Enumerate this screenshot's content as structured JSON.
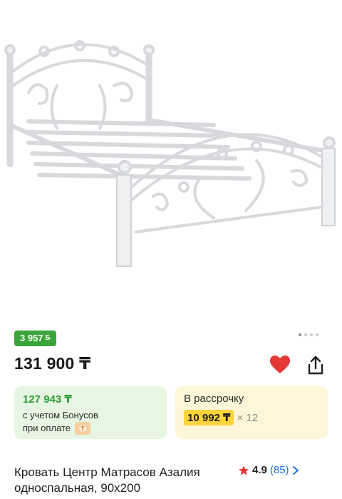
{
  "product": {
    "image_alt": "Кровать",
    "bonus_badge": "3 957",
    "bonus_symbol": "Б",
    "price": "131 900 ₸",
    "title": "Кровать Центр Матрасов Азалия односпальная, 90x200",
    "rating": "4.9",
    "reviews": "(85)"
  },
  "carousel": {
    "dots": 4,
    "active": 0
  },
  "bonus_card": {
    "price": "127 943 ₸",
    "note_line1": "с учетом Бонусов",
    "note_line2": "при оплате"
  },
  "installment_card": {
    "title": "В рассрочку",
    "amount": "10 992 ₸",
    "months": "× 12"
  },
  "icons": {
    "favorite": "heart-icon",
    "share": "share-icon",
    "rating": "star-icon",
    "reviews_link": "chevron-right-icon",
    "payment": "payment-logo-icon"
  },
  "colors": {
    "bonus_green": "#3aa53a",
    "installment_yellow": "#ffd43b",
    "heart_red": "#e53935",
    "star_red": "#e53935",
    "link_blue": "#1e6fd9"
  }
}
